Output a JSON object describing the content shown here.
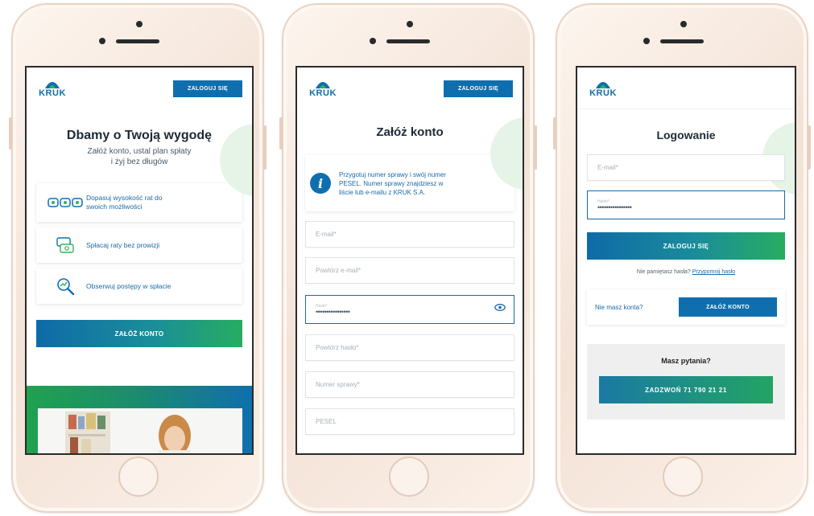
{
  "brand": {
    "name": "KRUK",
    "blue": "#0f6fae",
    "green": "#27ad60"
  },
  "phone1": {
    "login_button": "ZALOGUJ SIĘ",
    "title": "Dbamy o Twoją wygodę",
    "subtitle_line1": "Załóż konto, ustal plan spłaty",
    "subtitle_line2": "i żyj bez długów",
    "features": [
      {
        "icon": "installments-icon",
        "text_line1": "Dopasuj wysokość rat do",
        "text_line2": "swoich możliwości"
      },
      {
        "icon": "money-transfer-icon",
        "text_line1": "Spłacaj raty bez prowizji",
        "text_line2": ""
      },
      {
        "icon": "progress-magnifier-icon",
        "text_line1": "Obserwuj postępy w spłacie",
        "text_line2": ""
      }
    ],
    "cta": "ZAŁÓŻ KONTO"
  },
  "phone2": {
    "login_button": "ZALOGUJ SIĘ",
    "title": "Załóż konto",
    "info_line1": "Przygotuj numer sprawy i swój numer",
    "info_line2": "PESEL. Numer sprawy znajdziesz w",
    "info_line3": "liście lub e-mailu z KRUK S.A.",
    "fields": {
      "email": "E-mail*",
      "email_repeat": "Powtórz e-mail*",
      "password_label": "Hasło*",
      "password_value": "••••••••••••••••",
      "password_repeat": "Powtórz hasło*",
      "case_number": "Numer sprawy*",
      "pesel": "PESEL"
    }
  },
  "phone3": {
    "title": "Logowanie",
    "fields": {
      "email": "E-mail*",
      "password_label": "Hasło*",
      "password_value": "••••••••••••••••"
    },
    "login_button": "ZALOGUJ SIĘ",
    "forgot_text": "Nie pamiętasz hasła?",
    "forgot_link": "Przypomnij hasło",
    "no_account": "Nie masz konta?",
    "create_account": "ZAŁÓŻ KONTO",
    "questions": "Masz pytania?",
    "call_button": "ZADZWOŃ 71 790 21 21"
  }
}
